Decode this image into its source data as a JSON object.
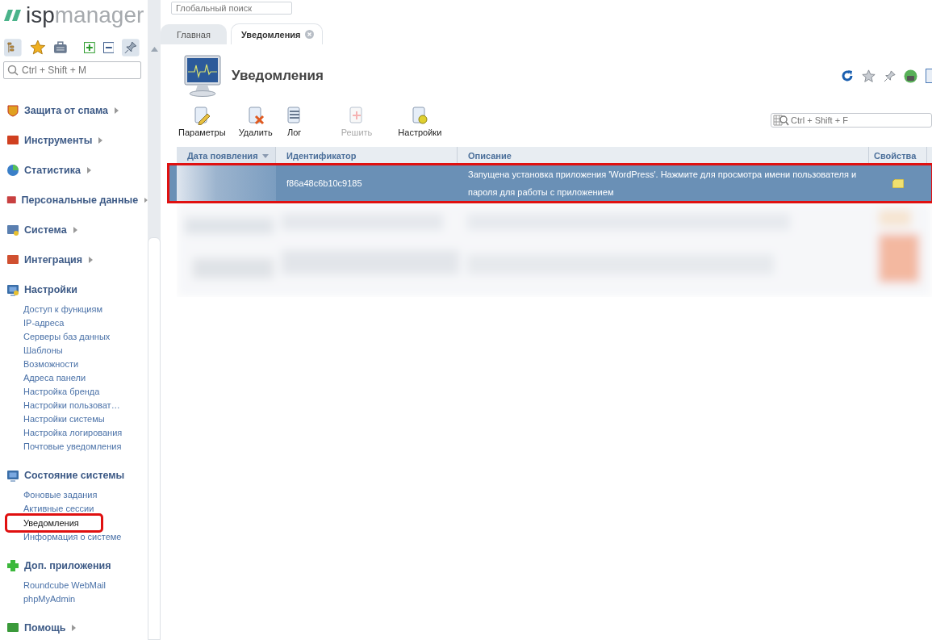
{
  "logo": {
    "brand_a": "isp",
    "brand_b": "manager"
  },
  "global_search": {
    "placeholder": "Глобальный поиск"
  },
  "sidebar": {
    "search": {
      "placeholder": "Ctrl + Shift + M"
    },
    "groups": [
      {
        "label": "Защита от спама",
        "expanded": false
      },
      {
        "label": "Инструменты",
        "expanded": false
      },
      {
        "label": "Статистика",
        "expanded": false
      },
      {
        "label": "Персональные данные",
        "expanded": false
      },
      {
        "label": "Система",
        "expanded": false
      },
      {
        "label": "Интеграция",
        "expanded": false
      },
      {
        "label": "Настройки",
        "expanded": true,
        "children": [
          {
            "label": "Доступ к функциям",
            "selected": false,
            "highlighted": false
          },
          {
            "label": "IP-адреса",
            "selected": false,
            "highlighted": false
          },
          {
            "label": "Серверы баз данных",
            "selected": false,
            "highlighted": false
          },
          {
            "label": "Шаблоны",
            "selected": false,
            "highlighted": false
          },
          {
            "label": "Возможности",
            "selected": false,
            "highlighted": false
          },
          {
            "label": "Адреса панели",
            "selected": false,
            "highlighted": false
          },
          {
            "label": "Настройка бренда",
            "selected": false,
            "highlighted": false
          },
          {
            "label": "Настройки пользоват…",
            "selected": false,
            "highlighted": false
          },
          {
            "label": "Настройки системы",
            "selected": false,
            "highlighted": false
          },
          {
            "label": "Настройка логирования",
            "selected": false,
            "highlighted": false
          },
          {
            "label": "Почтовые уведомления",
            "selected": false,
            "highlighted": false
          }
        ]
      },
      {
        "label": "Состояние системы",
        "expanded": true,
        "children": [
          {
            "label": "Фоновые задания",
            "selected": false,
            "highlighted": false
          },
          {
            "label": "Активные сессии",
            "selected": false,
            "highlighted": false
          },
          {
            "label": "Уведомления",
            "selected": true,
            "highlighted": true
          },
          {
            "label": "Информация о системе",
            "selected": false,
            "highlighted": false
          }
        ]
      },
      {
        "label": "Доп. приложения",
        "expanded": true,
        "children": [
          {
            "label": "Roundcube WebMail",
            "selected": false,
            "highlighted": false
          },
          {
            "label": "phpMyAdmin",
            "selected": false,
            "highlighted": false
          }
        ]
      },
      {
        "label": "Помощь",
        "expanded": false
      }
    ]
  },
  "tabs": [
    {
      "label": "Главная",
      "selected": false
    },
    {
      "label": "Уведомления",
      "selected": true
    }
  ],
  "page": {
    "title": "Уведомления",
    "toolbar": [
      {
        "label": "Параметры",
        "disabled": false
      },
      {
        "label": "Удалить",
        "disabled": false
      },
      {
        "label": "Лог",
        "disabled": false
      },
      {
        "label": "Решить",
        "disabled": true
      },
      {
        "label": "Настройки",
        "disabled": false
      }
    ],
    "filter": {
      "placeholder": "Ctrl + Shift + F"
    },
    "table": {
      "columns": [
        {
          "label": "Дата появления",
          "sorted": true
        },
        {
          "label": "Идентификатор",
          "sorted": false
        },
        {
          "label": "Описание",
          "sorted": false
        },
        {
          "label": "Свойства",
          "sorted": false
        }
      ],
      "rows": [
        {
          "identifier": "f86a48c6b10c9185",
          "description": "Запущена установка приложения 'WordPress'. Нажмите для просмотра имени пользователя и пароля для работы с приложением",
          "selected": true,
          "highlighted": true
        }
      ]
    }
  }
}
